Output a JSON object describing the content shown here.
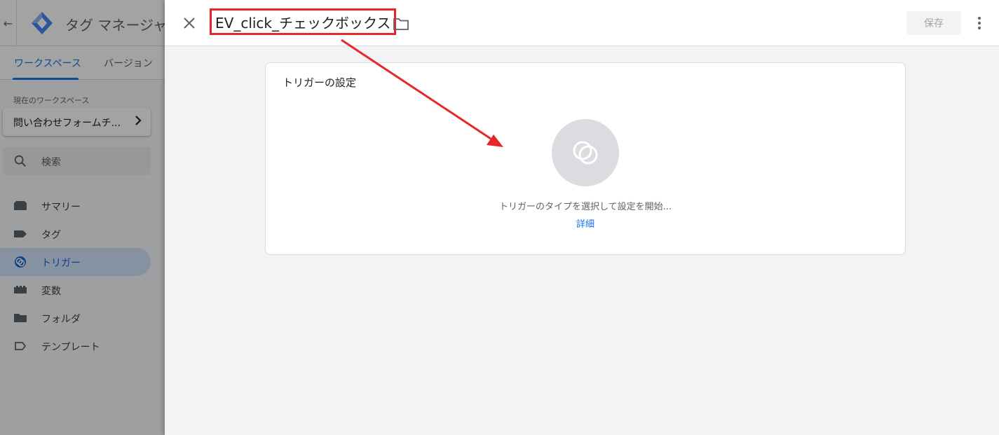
{
  "app": {
    "product_name": "タグ マネージャー",
    "tabs": [
      {
        "label": "ワークスペース",
        "active": true
      },
      {
        "label": "バージョン",
        "active": false
      }
    ]
  },
  "sidebar": {
    "workspace_caption": "現在のワークスペース",
    "workspace_name": "問い合わせフォームチ...",
    "search_placeholder": "検索",
    "items": [
      {
        "label": "サマリー",
        "icon": "inbox-icon",
        "active": false
      },
      {
        "label": "タグ",
        "icon": "tag-icon",
        "active": false
      },
      {
        "label": "トリガー",
        "icon": "trigger-icon",
        "active": true
      },
      {
        "label": "変数",
        "icon": "variables-icon",
        "active": false
      },
      {
        "label": "フォルダ",
        "icon": "folder-icon",
        "active": false
      },
      {
        "label": "テンプレート",
        "icon": "template-icon",
        "active": false
      }
    ]
  },
  "editor": {
    "trigger_name": "EV_click_チェックボックス",
    "save_label": "保存",
    "card_title": "トリガーの設定",
    "empty_message": "トリガーのタイプを選択して設定を開始...",
    "learn_more_label": "詳細"
  },
  "colors": {
    "accent_blue": "#1a73e8",
    "annotation_red": "#e8262a",
    "active_nav_bg": "#d2e3fc"
  }
}
